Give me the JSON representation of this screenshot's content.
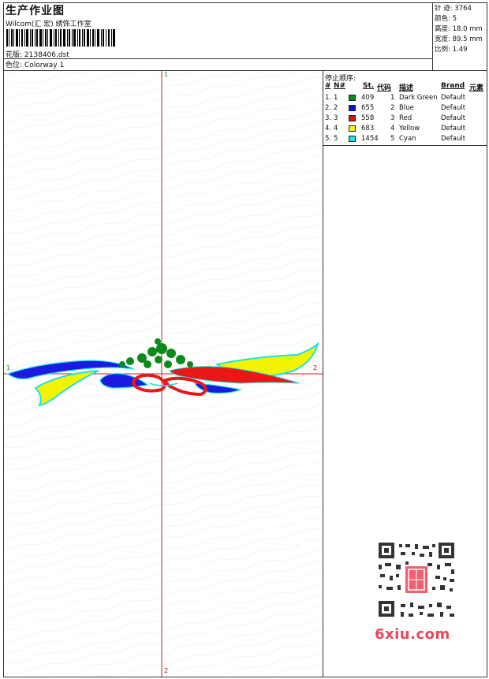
{
  "header": {
    "title": "生产作业图",
    "subtitle": "Wilcom(汇 宏) 绣饰工作室",
    "file_label": "花版:",
    "file_name": "2138406.dst",
    "color_label": "色位:",
    "color_name": "Colorway 1"
  },
  "stats": [
    {
      "label": "针 迹:",
      "value": "3764"
    },
    {
      "label": "颜色:",
      "value": "5"
    },
    {
      "label": "高度:",
      "value": "18.0 mm"
    },
    {
      "label": "宽度:",
      "value": "89.5 mm"
    },
    {
      "label": "比例:",
      "value": "1.49"
    }
  ],
  "markers": {
    "top": "1",
    "bottom": "2",
    "left": "1",
    "right": "2"
  },
  "stop_sequence": {
    "title": "停止顺序:",
    "columns": [
      "#",
      "N#",
      "St.",
      "代码",
      "描述",
      "Brand",
      "元素"
    ],
    "rows": [
      {
        "idx": "1.",
        "n": "1",
        "color": "#0a8a1a",
        "st": "409",
        "code": "1",
        "desc": "Dark Green",
        "brand": "Default"
      },
      {
        "idx": "2.",
        "n": "2",
        "color": "#1010e0",
        "st": "655",
        "code": "2",
        "desc": "Blue",
        "brand": "Default"
      },
      {
        "idx": "3.",
        "n": "3",
        "color": "#e01010",
        "st": "558",
        "code": "3",
        "desc": "Red",
        "brand": "Default"
      },
      {
        "idx": "4.",
        "n": "4",
        "color": "#f4f400",
        "st": "683",
        "code": "4",
        "desc": "Yellow",
        "brand": "Default"
      },
      {
        "idx": "5.",
        "n": "5",
        "color": "#20e0e8",
        "st": "1454",
        "code": "5",
        "desc": "Cyan",
        "brand": "Default"
      }
    ]
  },
  "watermark": {
    "site": "6xiu.com"
  }
}
